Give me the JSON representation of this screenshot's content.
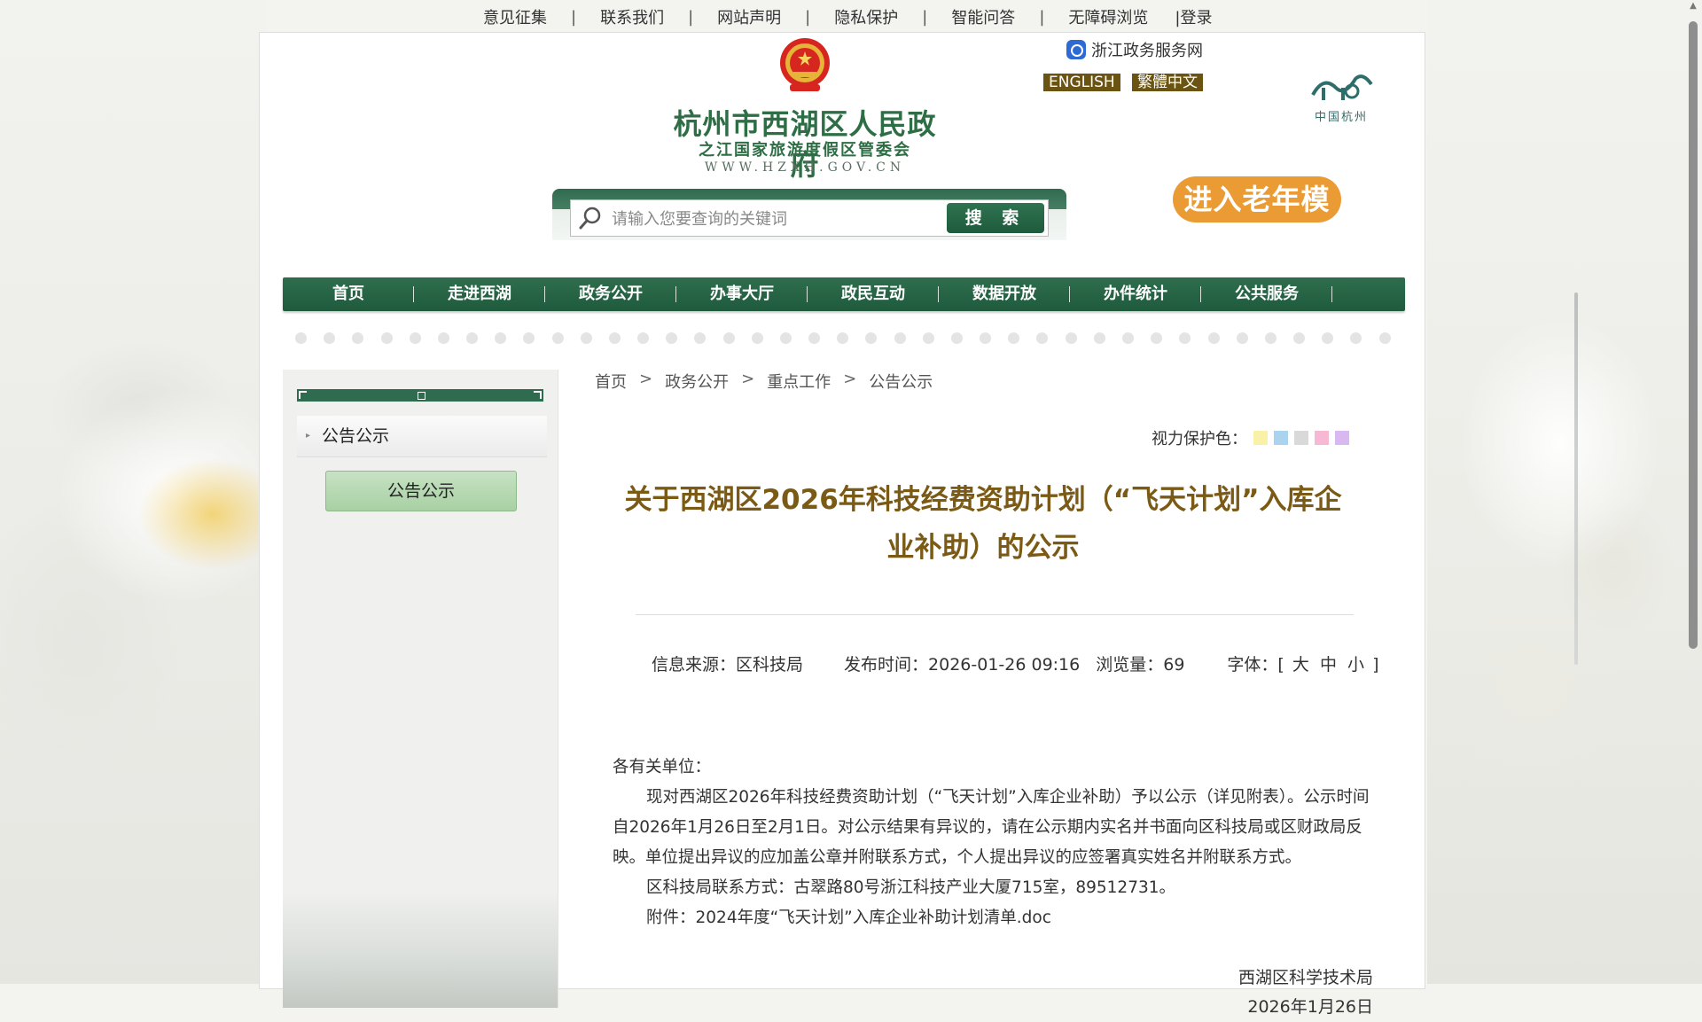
{
  "top_links": [
    "意见征集",
    "联系我们",
    "网站声明",
    "隐私保护",
    "智能问答",
    "无障碍浏览"
  ],
  "login_label": "|登录",
  "header": {
    "site_title": "杭州市西湖区人民政府",
    "site_subtitle": "之江国家旅游度假区管委会",
    "site_url": "WWW.HZXH.GOV.CN",
    "zj_service": "浙江政务服务网",
    "english": "ENGLISH",
    "traditional": "繁體中文",
    "hz_logo_caption": "中国杭州",
    "elder_mode": "进入老年模式"
  },
  "search": {
    "placeholder": "请输入您要查询的关键词",
    "button": "搜 索"
  },
  "nav": [
    "首页",
    "走进西湖",
    "政务公开",
    "办事大厅",
    "政民互动",
    "数据开放",
    "办件统计",
    "公共服务"
  ],
  "sidebar": {
    "item": "公告公示",
    "button": "公告公示"
  },
  "breadcrumb": [
    "首页",
    "政务公开",
    "重点工作",
    "公告公示"
  ],
  "breadcrumb_sep": ">",
  "eye_protect": {
    "label": "视力保护色：",
    "colors": [
      "#faf1a8",
      "#a9d3ef",
      "#d9d9d9",
      "#f6b8d3",
      "#d9b8f2"
    ]
  },
  "article": {
    "title": "关于西湖区2026年科技经费资助计划（“飞天计划”入库企业补助）的公示",
    "source": "信息来源：区科技局",
    "publish_time": "发布时间：2026-01-26 09:16",
    "views": "浏览量：69",
    "font_label": "字体：[",
    "font_sizes": [
      "大",
      "中",
      "小"
    ],
    "font_close": "]",
    "greeting": "各有关单位：",
    "para1": "现对西湖区2026年科技经费资助计划（“飞天计划”入库企业补助）予以公示（详见附表）。公示时间自2026年1月26日至2月1日。对公示结果有异议的，请在公示期内实名并书面向区科技局或区财政局反映。单位提出异议的应加盖公章并附联系方式，个人提出异议的应签署真实姓名并附联系方式。",
    "para2": "区科技局联系方式：古翠路80号浙江科技产业大厦715室，89512731。",
    "attachment_label": "附件：",
    "attachment_name": "2024年度“飞天计划”入库企业补助计划清单.doc",
    "signer": "西湖区科学技术局",
    "sign_date": "2026年1月26日"
  }
}
